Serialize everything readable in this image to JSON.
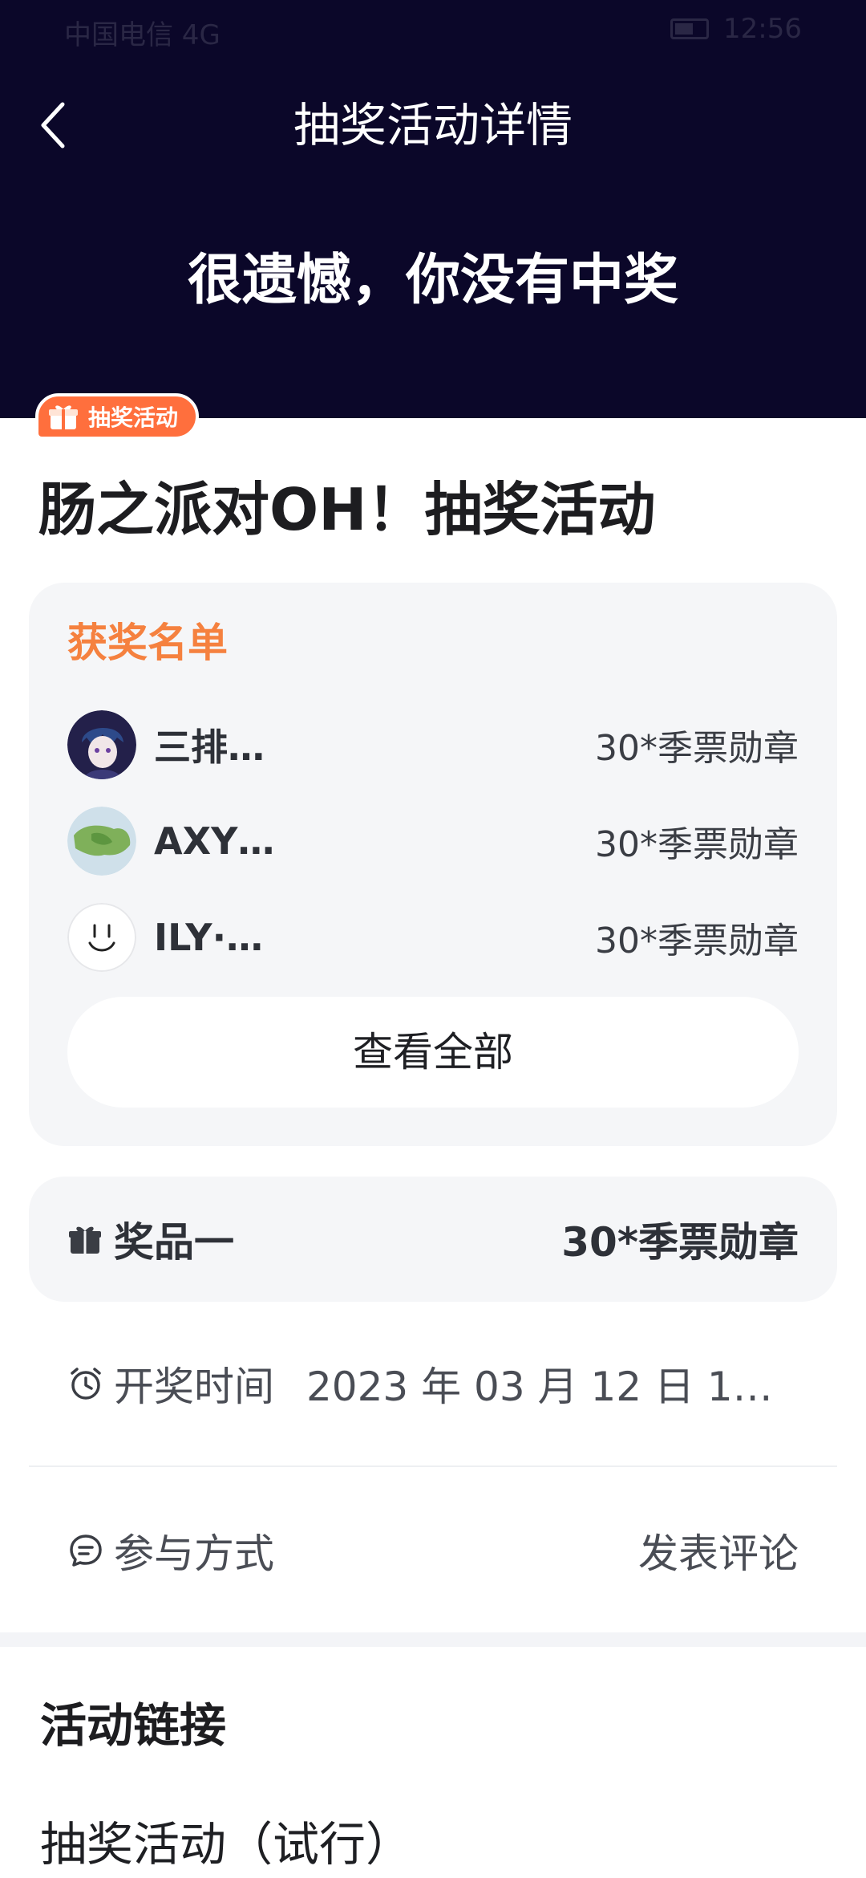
{
  "status_bar": {
    "carrier": "中国电信 4G",
    "time": "12:56"
  },
  "nav": {
    "title": "抽奖活动详情"
  },
  "result": {
    "message": "很遗憾，你没有中奖"
  },
  "event": {
    "tag": "抽奖活动",
    "title": "肠之派对OH！抽奖活动"
  },
  "winners": {
    "title": "获奖名单",
    "items": [
      {
        "name": "三排…",
        "prize": "30*季票勋章"
      },
      {
        "name": "AXY…",
        "prize": "30*季票勋章"
      },
      {
        "name": "ILY·…",
        "prize": "30*季票勋章"
      }
    ],
    "view_all": "查看全部"
  },
  "prize": {
    "label": "奖品一",
    "value": "30*季票勋章"
  },
  "draw": {
    "label": "开奖时间",
    "time": "2023 年 03 月 12 日 1…"
  },
  "participation": {
    "label": "参与方式",
    "action": "发表评论"
  },
  "links": {
    "title": "活动链接",
    "item": "抽奖活动（试行）"
  },
  "colors": {
    "hero_bg": "#0b0729",
    "accent_orange": "#f5813f",
    "tag_bg": "#ff6f3d",
    "card_bg": "#f5f6f8"
  }
}
